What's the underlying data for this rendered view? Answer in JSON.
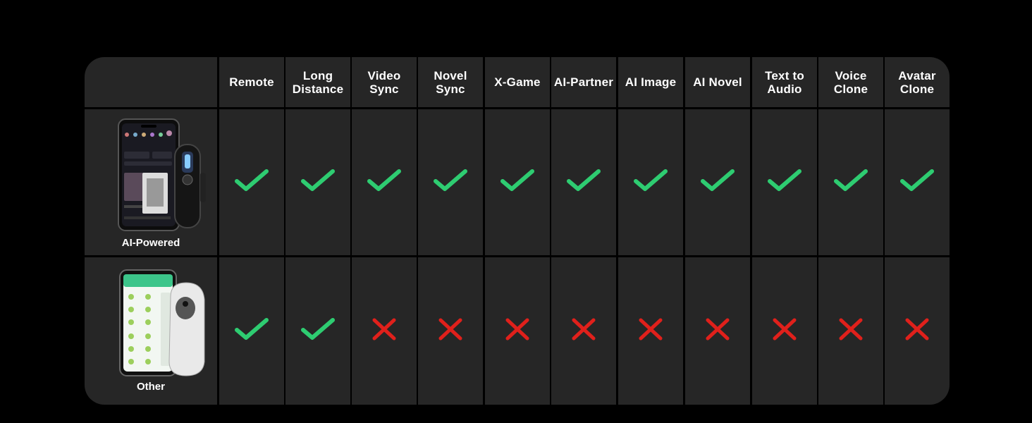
{
  "columns": [
    "Remote",
    "Long\nDistance",
    "Video\nSync",
    "Novel\nSync",
    "X-Game",
    "AI-Partner",
    "AI Image",
    "AI Novel",
    "Text to\nAudio",
    "Voice\nClone",
    "Avatar\nClone"
  ],
  "rows": [
    {
      "label": "AI-Powered",
      "values": [
        true,
        true,
        true,
        true,
        true,
        true,
        true,
        true,
        true,
        true,
        true
      ]
    },
    {
      "label": "Other",
      "values": [
        true,
        true,
        false,
        false,
        false,
        false,
        false,
        false,
        false,
        false,
        false
      ]
    }
  ],
  "colors": {
    "check": "#2ecc71",
    "cross": "#e0201b",
    "cell": "#262626",
    "background": "#000000"
  },
  "icons": {
    "check": "check-icon",
    "cross": "cross-icon"
  }
}
